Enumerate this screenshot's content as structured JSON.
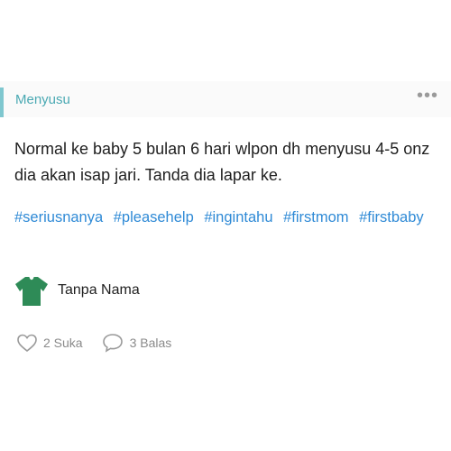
{
  "post": {
    "category": "Menyusu",
    "more_icon": "more-dots-icon",
    "body": "Normal ke baby 5 bulan 6 hari wlpon dh menyusu 4-5 onz dia akan isap jari. Tanda dia lapar ke.",
    "hashtags": [
      "#seriusnanya",
      "#pleasehelp",
      "#ingintahu",
      "#firstmom",
      "#firstbaby"
    ],
    "author": {
      "name": "Tanpa Nama",
      "avatar_icon": "anonymous-shirt-avatar-icon"
    },
    "actions": {
      "like_label": "2 Suka",
      "reply_label": "3 Balas"
    }
  },
  "colors": {
    "accent": "#7fc7cf",
    "category_text": "#4aa9b3",
    "hashtag": "#2f8ad6",
    "avatar": "#2e8b57"
  }
}
